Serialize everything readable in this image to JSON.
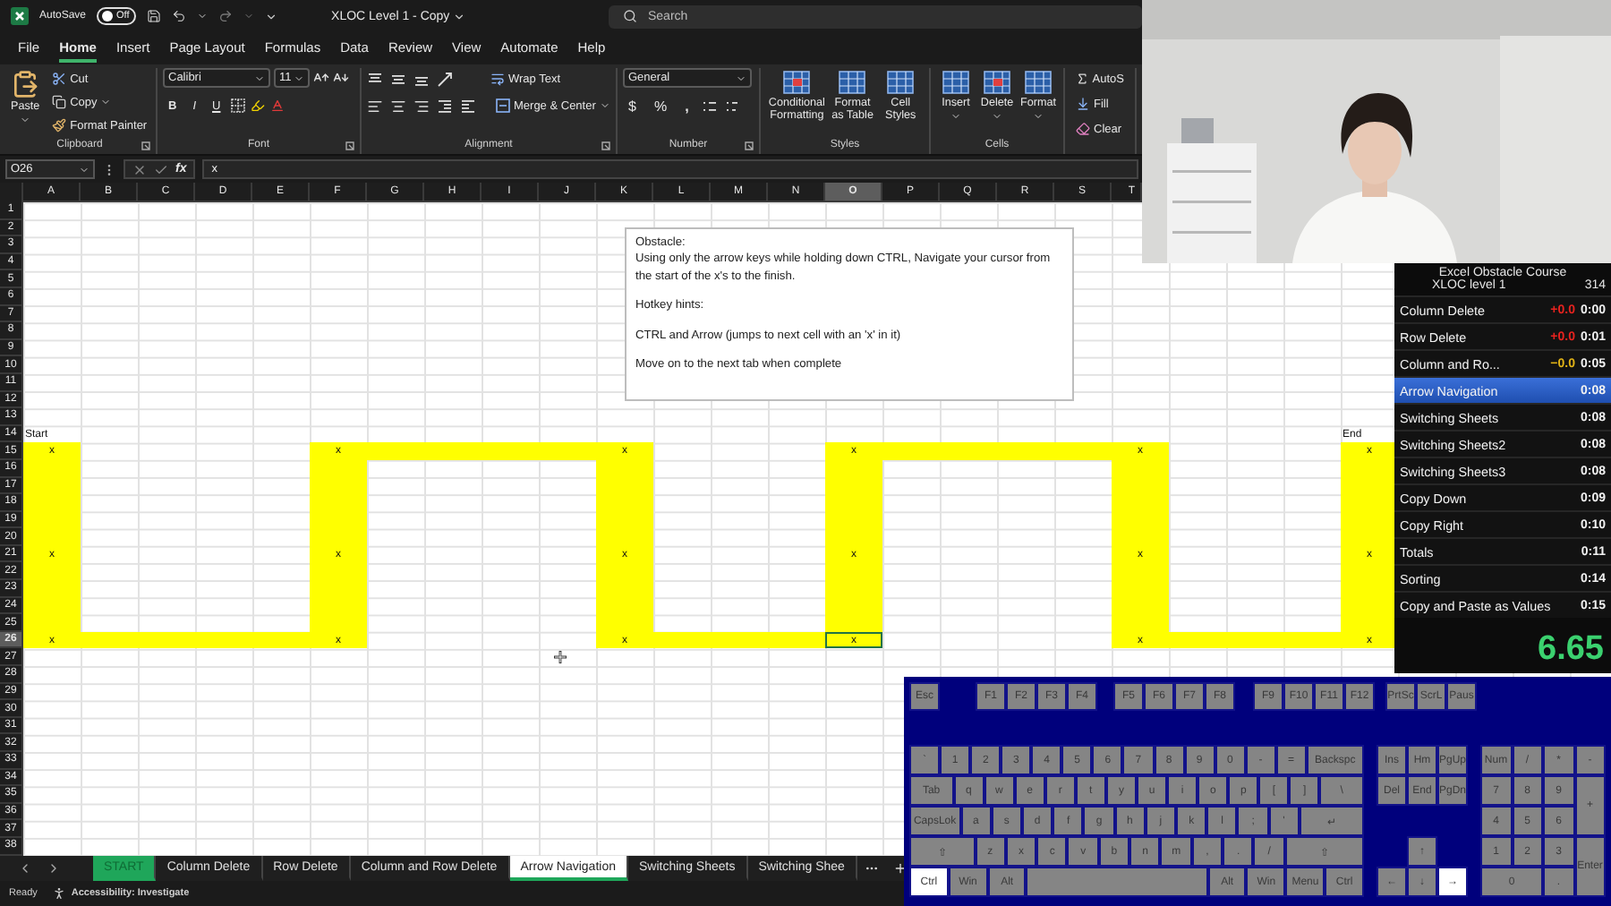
{
  "title_bar": {
    "autosave_label": "AutoSave",
    "autosave": {
      "label": "Off",
      "on": false
    },
    "document_title": "XLOC Level 1 - Copy",
    "search": {
      "placeholder": "Search"
    }
  },
  "menu": [
    {
      "label": "File",
      "selected": false
    },
    {
      "label": "Home",
      "selected": true
    },
    {
      "label": "Insert",
      "selected": false
    },
    {
      "label": "Page Layout",
      "selected": false
    },
    {
      "label": "Formulas",
      "selected": false
    },
    {
      "label": "Data",
      "selected": false
    },
    {
      "label": "Review",
      "selected": false
    },
    {
      "label": "View",
      "selected": false
    },
    {
      "label": "Automate",
      "selected": false
    },
    {
      "label": "Help",
      "selected": false
    }
  ],
  "ribbon": {
    "clipboard": {
      "paste": "Paste",
      "cut": "Cut",
      "copy": "Copy",
      "format_painter": "Format Painter",
      "label": "Clipboard"
    },
    "font": {
      "name": "Calibri",
      "size": "11",
      "bold": "B",
      "italic": "I",
      "underline": "U",
      "label": "Font"
    },
    "alignment": {
      "wrap": "Wrap Text",
      "merge": "Merge & Center",
      "label": "Alignment"
    },
    "number": {
      "format": "General",
      "currency": "$",
      "percent": "%",
      "comma": ",",
      "label": "Number"
    },
    "styles": {
      "buttons": [
        "Conditional Formatting",
        "Format as Table",
        "Cell Styles"
      ],
      "label": "Styles"
    },
    "cells": {
      "buttons": [
        "Insert",
        "Delete",
        "Format"
      ],
      "label": "Cells"
    },
    "editing": {
      "items": [
        "AutoS",
        "Fill",
        "Clear"
      ]
    }
  },
  "formula_bar": {
    "name_box": "O26",
    "fx": "fx",
    "value": "x"
  },
  "sheet": {
    "columns": [
      {
        "label": "A",
        "selected": false
      },
      {
        "label": "B",
        "selected": false
      },
      {
        "label": "C",
        "selected": false
      },
      {
        "label": "D",
        "selected": false
      },
      {
        "label": "E",
        "selected": false
      },
      {
        "label": "F",
        "selected": false
      },
      {
        "label": "G",
        "selected": false
      },
      {
        "label": "H",
        "selected": false
      },
      {
        "label": "I",
        "selected": false
      },
      {
        "label": "J",
        "selected": false
      },
      {
        "label": "K",
        "selected": false
      },
      {
        "label": "L",
        "selected": false
      },
      {
        "label": "M",
        "selected": false
      },
      {
        "label": "N",
        "selected": false
      },
      {
        "label": "O",
        "selected": true
      },
      {
        "label": "P",
        "selected": false
      },
      {
        "label": "Q",
        "selected": false
      },
      {
        "label": "R",
        "selected": false
      },
      {
        "label": "S",
        "selected": false
      },
      {
        "label": "T",
        "selected": false
      }
    ],
    "rows": [
      {
        "label": "1",
        "selected": false
      },
      {
        "label": "2",
        "selected": false
      },
      {
        "label": "3",
        "selected": false
      },
      {
        "label": "4",
        "selected": false
      },
      {
        "label": "5",
        "selected": false
      },
      {
        "label": "6",
        "selected": false
      },
      {
        "label": "7",
        "selected": false
      },
      {
        "label": "8",
        "selected": false
      },
      {
        "label": "9",
        "selected": false
      },
      {
        "label": "10",
        "selected": false
      },
      {
        "label": "11",
        "selected": false
      },
      {
        "label": "12",
        "selected": false
      },
      {
        "label": "13",
        "selected": false
      },
      {
        "label": "14",
        "selected": false
      },
      {
        "label": "15",
        "selected": false
      },
      {
        "label": "16",
        "selected": false
      },
      {
        "label": "17",
        "selected": false
      },
      {
        "label": "18",
        "selected": false
      },
      {
        "label": "19",
        "selected": false
      },
      {
        "label": "20",
        "selected": false
      },
      {
        "label": "21",
        "selected": false
      },
      {
        "label": "22",
        "selected": false
      },
      {
        "label": "23",
        "selected": false
      },
      {
        "label": "24",
        "selected": false
      },
      {
        "label": "25",
        "selected": false
      },
      {
        "label": "26",
        "selected": true
      },
      {
        "label": "27",
        "selected": false
      },
      {
        "label": "28",
        "selected": false
      },
      {
        "label": "29",
        "selected": false
      },
      {
        "label": "30",
        "selected": false
      },
      {
        "label": "31",
        "selected": false
      },
      {
        "label": "32",
        "selected": false
      },
      {
        "label": "33",
        "selected": false
      },
      {
        "label": "34",
        "selected": false
      },
      {
        "label": "35",
        "selected": false
      },
      {
        "label": "36",
        "selected": false
      },
      {
        "label": "37",
        "selected": false
      },
      {
        "label": "38",
        "selected": false
      }
    ],
    "cells": [
      {
        "text": "Start",
        "kind": "label",
        "selected": false
      },
      {
        "text": "End",
        "kind": "label",
        "selected": false
      },
      {
        "text": "x",
        "kind": "mark",
        "selected": false
      },
      {
        "text": "x",
        "kind": "mark",
        "selected": false
      },
      {
        "text": "x",
        "kind": "mark",
        "selected": false
      },
      {
        "text": "x",
        "kind": "mark",
        "selected": false
      },
      {
        "text": "x",
        "kind": "mark",
        "selected": false
      },
      {
        "text": "x",
        "kind": "mark",
        "selected": false
      },
      {
        "text": "x",
        "kind": "mark",
        "selected": false
      },
      {
        "text": "x",
        "kind": "mark",
        "selected": false
      },
      {
        "text": "x",
        "kind": "mark",
        "selected": false
      },
      {
        "text": "x",
        "kind": "mark",
        "selected": false
      },
      {
        "text": "x",
        "kind": "mark",
        "selected": false
      },
      {
        "text": "x",
        "kind": "mark",
        "selected": true
      },
      {
        "text": "x",
        "kind": "mark",
        "selected": false
      },
      {
        "text": "x",
        "kind": "mark",
        "selected": false
      },
      {
        "text": "x",
        "kind": "mark",
        "selected": false
      },
      {
        "text": "x",
        "kind": "mark",
        "selected": false
      },
      {
        "text": "x",
        "kind": "mark",
        "selected": false
      },
      {
        "text": "x",
        "kind": "mark",
        "selected": false
      }
    ],
    "note": {
      "paragraphs": [
        [
          "Obstacle:",
          "Using only the arrow keys while holding down CTRL, Navigate your cursor from the start of the x's to the finish."
        ],
        [
          "Hotkey hints:"
        ],
        [
          "CTRL and Arrow (jumps to next cell with an 'x' in it)"
        ],
        [
          "Move on to the next tab when complete"
        ]
      ]
    }
  },
  "sheet_tabs": [
    {
      "label": "START",
      "kind": "start",
      "selected": false
    },
    {
      "label": "Column Delete",
      "kind": "sheet",
      "selected": false
    },
    {
      "label": "Row Delete",
      "kind": "sheet",
      "selected": false
    },
    {
      "label": "Column and Row Delete",
      "kind": "sheet",
      "selected": false
    },
    {
      "label": "Arrow Navigation",
      "kind": "sheet",
      "selected": true
    },
    {
      "label": "Switching Sheets",
      "kind": "sheet",
      "selected": false
    },
    {
      "label": "Switching Shee",
      "kind": "sheet",
      "selected": false
    }
  ],
  "status_bar": {
    "mode": "Ready",
    "accessibility": "Accessibility: Investigate"
  },
  "timer": {
    "title": "Excel Obstacle Course",
    "subtitle": "XLOC level 1",
    "count": "314",
    "splits": [
      {
        "name": "Column Delete",
        "delta": "+0.0",
        "color": "#e8231f",
        "time": "0:00",
        "selected": false
      },
      {
        "name": "Row Delete",
        "delta": "+0.0",
        "color": "#e8231f",
        "time": "0:01",
        "selected": false
      },
      {
        "name": "Column and Ro...",
        "delta": "−0.0",
        "color": "#e3b416",
        "time": "0:05",
        "selected": false
      },
      {
        "name": "Arrow Navigation",
        "time": "0:08",
        "selected": true
      },
      {
        "name": "Switching Sheets",
        "time": "0:08",
        "selected": false
      },
      {
        "name": "Switching Sheets2",
        "time": "0:08",
        "selected": false
      },
      {
        "name": "Switching Sheets3",
        "time": "0:08",
        "selected": false
      },
      {
        "name": "Copy Down",
        "time": "0:09",
        "selected": false
      },
      {
        "name": "Copy Right",
        "time": "0:10",
        "selected": false
      },
      {
        "name": "Totals",
        "time": "0:11",
        "selected": false
      },
      {
        "name": "Sorting",
        "time": "0:14",
        "selected": false
      },
      {
        "name": "Copy and Paste as Values",
        "time": "0:15",
        "selected": false
      }
    ],
    "total": "6.65"
  },
  "keyboard": {
    "function_groups": [
      [
        {
          "label": "Esc",
          "pressed": false
        }
      ],
      [
        {
          "label": "F1",
          "pressed": false
        },
        {
          "label": "F2",
          "pressed": false
        },
        {
          "label": "F3",
          "pressed": false
        },
        {
          "label": "F4",
          "pressed": false
        }
      ],
      [
        {
          "label": "F5",
          "pressed": false
        },
        {
          "label": "F6",
          "pressed": false
        },
        {
          "label": "F7",
          "pressed": false
        },
        {
          "label": "F8",
          "pressed": false
        }
      ],
      [
        {
          "label": "F9",
          "pressed": false
        },
        {
          "label": "F10",
          "pressed": false
        },
        {
          "label": "F11",
          "pressed": false
        },
        {
          "label": "F12",
          "pressed": false
        }
      ],
      [
        {
          "label": "PrtSc",
          "pressed": false
        },
        {
          "label": "ScrL",
          "pressed": false
        },
        {
          "label": "Paus",
          "pressed": false
        }
      ]
    ],
    "main_rows": [
      [
        {
          "label": "`",
          "kind": "key",
          "pressed": false
        },
        {
          "label": "1",
          "kind": "key",
          "pressed": false
        },
        {
          "label": "2",
          "kind": "key",
          "pressed": false
        },
        {
          "label": "3",
          "kind": "key",
          "pressed": false
        },
        {
          "label": "4",
          "kind": "key",
          "pressed": false
        },
        {
          "label": "5",
          "kind": "key",
          "pressed": false
        },
        {
          "label": "6",
          "kind": "key",
          "pressed": false
        },
        {
          "label": "7",
          "kind": "key",
          "pressed": false
        },
        {
          "label": "8",
          "kind": "key",
          "pressed": false
        },
        {
          "label": "9",
          "kind": "key",
          "pressed": false
        },
        {
          "label": "0",
          "kind": "key",
          "pressed": false
        },
        {
          "label": "-",
          "kind": "key",
          "pressed": false
        },
        {
          "label": "=",
          "kind": "key",
          "pressed": false
        },
        {
          "label": "Backspc",
          "kind": "backspace",
          "pressed": false
        }
      ],
      [
        {
          "label": "Tab",
          "kind": "tab",
          "pressed": false
        },
        {
          "label": "q",
          "kind": "key",
          "pressed": false
        },
        {
          "label": "w",
          "kind": "key",
          "pressed": false
        },
        {
          "label": "e",
          "kind": "key",
          "pressed": false
        },
        {
          "label": "r",
          "kind": "key",
          "pressed": false
        },
        {
          "label": "t",
          "kind": "key",
          "pressed": false
        },
        {
          "label": "y",
          "kind": "key",
          "pressed": false
        },
        {
          "label": "u",
          "kind": "key",
          "pressed": false
        },
        {
          "label": "i",
          "kind": "key",
          "pressed": false
        },
        {
          "label": "o",
          "kind": "key",
          "pressed": false
        },
        {
          "label": "p",
          "kind": "key",
          "pressed": false
        },
        {
          "label": "[",
          "kind": "key",
          "pressed": false
        },
        {
          "label": "]",
          "kind": "key",
          "pressed": false
        },
        {
          "label": "\\",
          "kind": "tab",
          "pressed": false
        }
      ],
      [
        {
          "label": "CapsLok",
          "kind": "caps",
          "pressed": false
        },
        {
          "label": "a",
          "kind": "key",
          "pressed": false
        },
        {
          "label": "s",
          "kind": "key",
          "pressed": false
        },
        {
          "label": "d",
          "kind": "key",
          "pressed": false
        },
        {
          "label": "f",
          "kind": "key",
          "pressed": false
        },
        {
          "label": "g",
          "kind": "key",
          "pressed": false
        },
        {
          "label": "h",
          "kind": "key",
          "pressed": false
        },
        {
          "label": "j",
          "kind": "key",
          "pressed": false
        },
        {
          "label": "k",
          "kind": "key",
          "pressed": false
        },
        {
          "label": "l",
          "kind": "key",
          "pressed": false
        },
        {
          "label": ";",
          "kind": "key",
          "pressed": false
        },
        {
          "label": "'",
          "kind": "key",
          "pressed": false
        },
        {
          "label": "↵",
          "kind": "enter",
          "pressed": false
        }
      ],
      [
        {
          "label": "⇧",
          "kind": "lshift",
          "pressed": false
        },
        {
          "label": "z",
          "kind": "key",
          "pressed": false
        },
        {
          "label": "x",
          "kind": "key",
          "pressed": false
        },
        {
          "label": "c",
          "kind": "key",
          "pressed": false
        },
        {
          "label": "v",
          "kind": "key",
          "pressed": false
        },
        {
          "label": "b",
          "kind": "key",
          "pressed": false
        },
        {
          "label": "n",
          "kind": "key",
          "pressed": false
        },
        {
          "label": "m",
          "kind": "key",
          "pressed": false
        },
        {
          "label": ",",
          "kind": "key",
          "pressed": false
        },
        {
          "label": ".",
          "kind": "key",
          "pressed": false
        },
        {
          "label": "/",
          "kind": "key",
          "pressed": false
        },
        {
          "label": "⇧",
          "kind": "rshift",
          "pressed": false
        }
      ],
      [
        {
          "label": "Ctrl",
          "kind": "mod",
          "pressed": true
        },
        {
          "label": "Win",
          "kind": "mod",
          "pressed": false
        },
        {
          "label": "Alt",
          "kind": "mod",
          "pressed": false
        },
        {
          "kind": "space",
          "pressed": false
        },
        {
          "label": "Alt",
          "kind": "mod",
          "pressed": false
        },
        {
          "label": "Win",
          "kind": "mod",
          "pressed": false
        },
        {
          "label": "Menu",
          "kind": "mod",
          "pressed": false
        },
        {
          "label": "Ctrl",
          "kind": "mod",
          "pressed": false
        }
      ]
    ],
    "edit_keys": [
      {
        "label": "Ins",
        "pressed": false
      },
      {
        "label": "Hm",
        "pressed": false
      },
      {
        "label": "PgUp",
        "pressed": false
      },
      {
        "label": "Del",
        "pressed": false
      },
      {
        "label": "End",
        "pressed": false
      },
      {
        "label": "PgDn",
        "pressed": false
      }
    ],
    "arrow_keys": [
      {
        "label": "↑",
        "pressed": false
      },
      {
        "label": "←",
        "pressed": false
      },
      {
        "label": "↓",
        "pressed": false
      },
      {
        "label": "→",
        "pressed": true
      }
    ],
    "numpad": [
      {
        "label": "Num",
        "kind": "key",
        "pressed": false
      },
      {
        "label": "/",
        "kind": "key",
        "pressed": false
      },
      {
        "label": "*",
        "kind": "key",
        "pressed": false
      },
      {
        "label": "-",
        "kind": "key",
        "pressed": false
      },
      {
        "label": "7",
        "kind": "key",
        "pressed": false
      },
      {
        "label": "8",
        "kind": "key",
        "pressed": false
      },
      {
        "label": "9",
        "kind": "key",
        "pressed": false
      },
      {
        "label": "+",
        "kind": "tall",
        "pressed": false
      },
      {
        "label": "4",
        "kind": "key",
        "pressed": false
      },
      {
        "label": "5",
        "kind": "key",
        "pressed": false
      },
      {
        "label": "6",
        "kind": "key",
        "pressed": false
      },
      {
        "label": "1",
        "kind": "key",
        "pressed": false
      },
      {
        "label": "2",
        "kind": "key",
        "pressed": false
      },
      {
        "label": "3",
        "kind": "key",
        "pressed": false
      },
      {
        "label": "Enter",
        "kind": "tall",
        "pressed": false
      },
      {
        "label": "0",
        "kind": "wide",
        "pressed": false
      },
      {
        "label": ".",
        "kind": "key",
        "pressed": false
      }
    ]
  }
}
